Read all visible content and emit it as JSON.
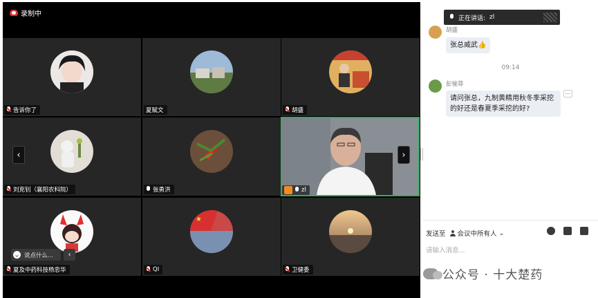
{
  "recording": {
    "label": "录制中"
  },
  "tiles": [
    {
      "name": "告诉你了",
      "mic": "muted",
      "avatar_color": "#e8e2df"
    },
    {
      "name": "夏赋文",
      "mic": "none",
      "avatar_color": "#8aa9c4"
    },
    {
      "name": "胡盛",
      "mic": "muted",
      "avatar_color": "#d8a050"
    },
    {
      "name": "刘克钊（襄阳农科院）",
      "mic": "muted",
      "avatar_color": "#d9d4cc"
    },
    {
      "name": "张勇洪",
      "mic": "on",
      "avatar_color": "#6b4f3a"
    },
    {
      "name": "zl",
      "mic": "on",
      "active": true
    },
    {
      "name": "夏及中药科技杨忠华",
      "mic": "muted",
      "avatar_color": "#fafafa"
    },
    {
      "name": "QI",
      "mic": "muted",
      "avatar_color": "#c94848"
    },
    {
      "name": "卫健委",
      "mic": "muted",
      "avatar_color": "#d9b07a"
    }
  ],
  "nav": {
    "prev": "‹",
    "next": "›"
  },
  "chat_input_mini": {
    "placeholder": "说点什么...",
    "collapse": "‹"
  },
  "speaking": {
    "label": "正在讲话:",
    "name": "zl"
  },
  "messages": [
    {
      "sender": "胡盛",
      "text": "张总威武👍"
    },
    {
      "sender": "彭愉菲",
      "text": "请问张总，九制黄精用秋冬季采挖的好还是春夏季采挖的好?"
    }
  ],
  "timestamp": "09:14",
  "composer": {
    "sendto_label": "发送至",
    "target": "会议中所有人",
    "placeholder": "请输入消息..."
  },
  "watermark": "公众号 · 十大楚药"
}
